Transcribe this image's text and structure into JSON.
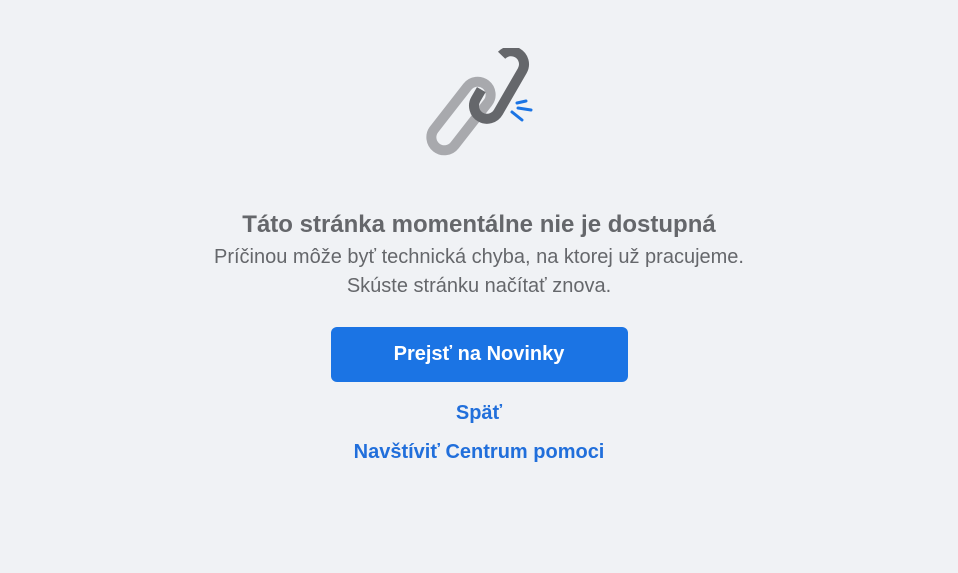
{
  "error": {
    "icon": "broken-link-icon",
    "title": "Táto stránka momentálne nie je dostupná",
    "line1": "Príčinou môže byť technická chyba, na ktorej už pracujeme.",
    "line2": "Skúste stránku načítať znova."
  },
  "actions": {
    "primary_label": "Prejsť na Novinky",
    "back_label": "Späť",
    "help_label": "Navštíviť Centrum pomoci"
  },
  "colors": {
    "background": "#f0f2f5",
    "primary": "#1b74e4",
    "link": "#216fdb",
    "text": "#65676b",
    "chain_light": "#a8a9ad",
    "chain_dark": "#65676b",
    "spark": "#1b74e4"
  }
}
